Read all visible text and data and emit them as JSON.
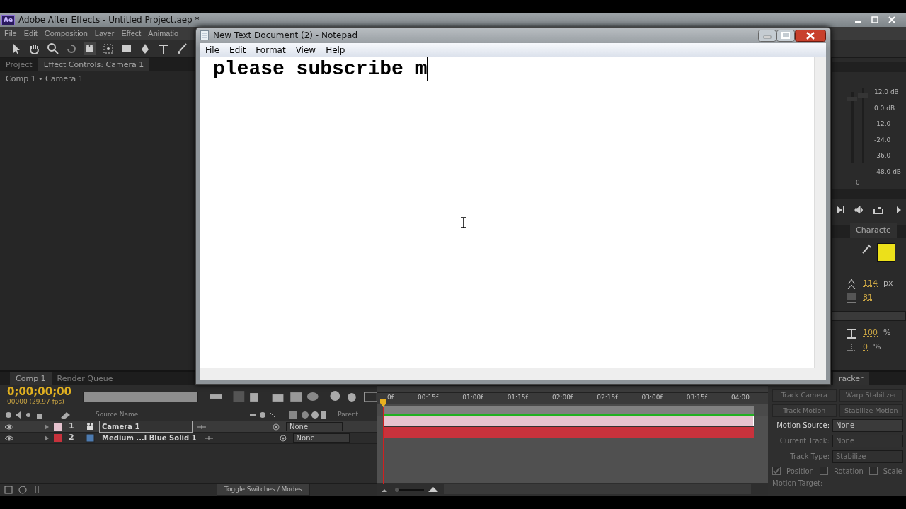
{
  "app": {
    "logo": "Ae",
    "title": "Adobe After Effects - Untitled Project.aep *",
    "menu": [
      "File",
      "Edit",
      "Composition",
      "Layer",
      "Effect",
      "Animatio"
    ]
  },
  "left_panel": {
    "tabs": [
      {
        "label": "Project",
        "selected": false
      },
      {
        "label": "Effect Controls: Camera 1",
        "selected": true
      }
    ],
    "breadcrumb": "Comp 1 • Camera 1"
  },
  "audio": {
    "labels": [
      "12.0 dB",
      "0.0 dB",
      "-12.0",
      "-24.0",
      "-36.0",
      "-48.0 dB"
    ],
    "reading": "0"
  },
  "character": {
    "tab": "Characte",
    "size": "114",
    "size_unit": "px",
    "tracking": "81",
    "scale": "100",
    "scale_unit": "%",
    "baseline": "0",
    "baseline_unit": "%"
  },
  "timeline": {
    "tabs": [
      {
        "label": "Comp 1",
        "selected": true
      },
      {
        "label": "Render Queue",
        "selected": false
      }
    ],
    "timecode": "0;00;00;00",
    "frame_info": "00000 (29.97 fps)",
    "columns": {
      "source": "Source Name",
      "parent": "Parent"
    },
    "layers": [
      {
        "number": "1",
        "name": "Camera 1",
        "kind": "camera",
        "color": "#e6c3cf",
        "selected": true,
        "parent": "None"
      },
      {
        "number": "2",
        "name": "Medium ...l Blue Solid 1",
        "kind": "solid",
        "color": "#c8323c",
        "selected": false,
        "parent": "None"
      }
    ],
    "ruler": [
      "0f",
      "00:15f",
      "01:00f",
      "01:15f",
      "02:00f",
      "02:15f",
      "03:00f",
      "03:15f",
      "04:00"
    ],
    "toggle_button": "Toggle Switches / Modes"
  },
  "tracker": {
    "tab": "racker",
    "buttons": [
      {
        "label": "Track Camera",
        "disabled": true
      },
      {
        "label": "Warp Stabilizer",
        "disabled": true
      },
      {
        "label": "Track Motion",
        "disabled": true
      },
      {
        "label": "Stabilize Motion",
        "disabled": true
      }
    ],
    "fields": [
      {
        "label": "Motion Source:",
        "value": "None",
        "disabled": false
      },
      {
        "label": "Current Track:",
        "value": "None",
        "disabled": true
      },
      {
        "label": "Track Type:",
        "value": "Stabilize",
        "disabled": true
      }
    ],
    "checkboxes": [
      {
        "label": "Position",
        "checked": true,
        "disabled": true
      },
      {
        "label": "Rotation",
        "checked": false,
        "disabled": true
      },
      {
        "label": "Scale",
        "checked": false,
        "disabled": true
      }
    ],
    "motion_target": "Motion Target:"
  },
  "notepad": {
    "title": "New Text Document (2) - Notepad",
    "menu": [
      "File",
      "Edit",
      "Format",
      "View",
      "Help"
    ],
    "text": "please subscribe m"
  }
}
